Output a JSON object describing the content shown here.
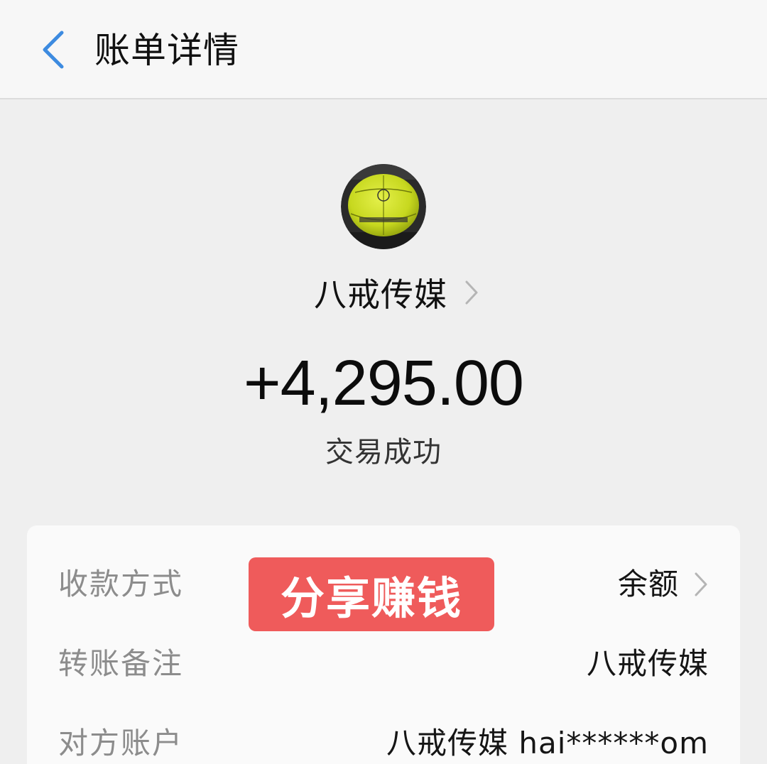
{
  "header": {
    "title": "账单详情",
    "back_icon": "chevron-left-icon",
    "accent_color": "#3d8be0"
  },
  "transaction": {
    "avatar_icon": "basketball-avatar",
    "payee_name": "八戒传媒",
    "amount": "+4,295.00",
    "status": "交易成功"
  },
  "details": {
    "rows": [
      {
        "label": "收款方式",
        "value": "余额",
        "has_chevron": true
      },
      {
        "label": "转账备注",
        "value": "八戒传媒",
        "has_chevron": false
      },
      {
        "label": "对方账户",
        "value": "八戒传媒 hai******om",
        "has_chevron": false
      }
    ]
  },
  "share_badge": {
    "label": "分享赚钱",
    "color": "#ef5b5b"
  }
}
